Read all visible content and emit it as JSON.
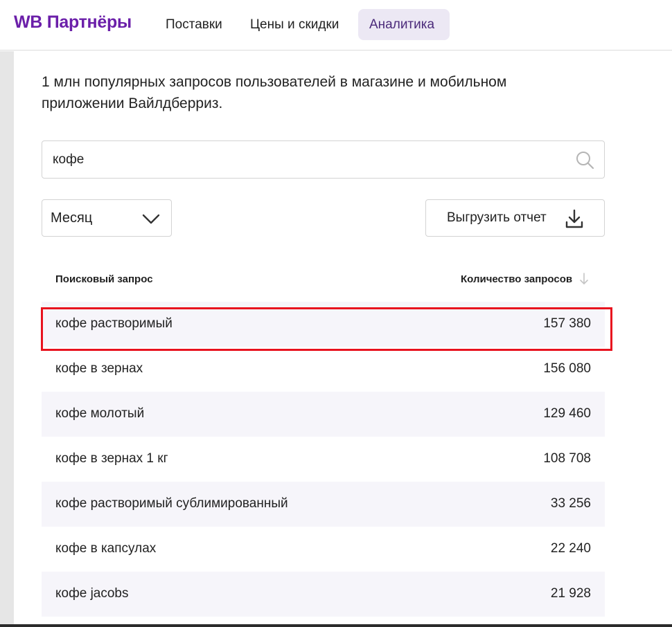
{
  "header": {
    "logo": "WB Партнёры",
    "nav": [
      {
        "label": "Поставки"
      },
      {
        "label": "Цены и скидки"
      },
      {
        "label": "Аналитика",
        "active": true
      }
    ]
  },
  "intro": "1 млн популярных запросов пользователей в магазине и мобильном приложении Вайлдберриз.",
  "search": {
    "value": "кофе",
    "icon": "search-icon"
  },
  "filters": {
    "period": {
      "selected": "Месяц",
      "icon": "chevron-down-icon"
    },
    "export": {
      "label": "Выгрузить отчет",
      "icon": "download-icon"
    }
  },
  "table": {
    "columns": [
      "Поисковый запрос",
      "Количество запросов"
    ],
    "sort_icon": "arrow-down-icon",
    "rows": [
      {
        "query": "кофе растворимый",
        "count": "157 380",
        "highlighted": true
      },
      {
        "query": "кофе в зернах",
        "count": "156 080"
      },
      {
        "query": "кофе молотый",
        "count": "129 460"
      },
      {
        "query": "кофе в зернах 1 кг",
        "count": "108 708"
      },
      {
        "query": "кофе растворимый сублимированный",
        "count": "33 256"
      },
      {
        "query": "кофе в капсулах",
        "count": "22 240"
      },
      {
        "query": "кофе jacobs",
        "count": "21 928"
      }
    ]
  },
  "colors": {
    "brand": "#6b1fa9",
    "active_tab_bg": "#ece8f4",
    "row_shade": "#f6f5fa",
    "highlight": "#e8121e"
  }
}
